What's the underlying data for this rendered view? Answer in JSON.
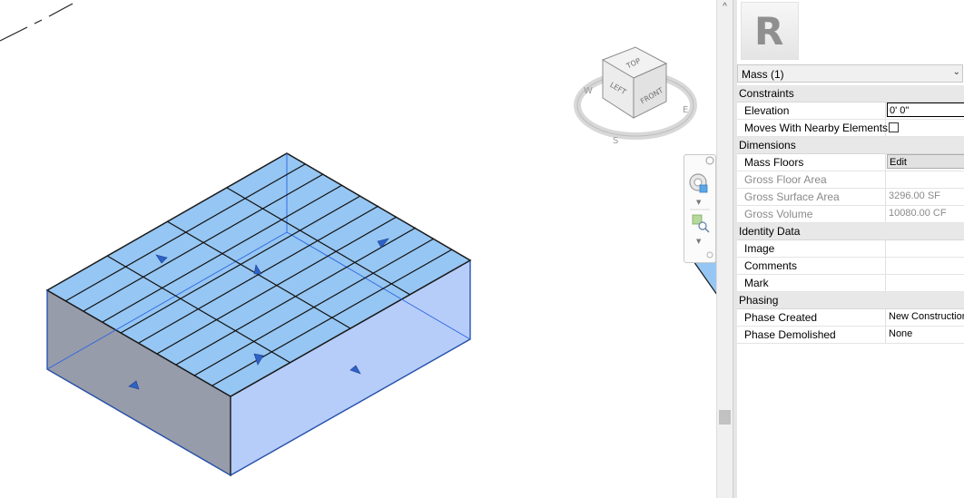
{
  "viewcube": {
    "top": "TOP",
    "left": "LEFT",
    "front": "FRONT"
  },
  "scrollbar": {
    "up_glyph": "^"
  },
  "properties": {
    "type_selector": "Mass (1)",
    "logo_letter": "R",
    "sections": {
      "constraints": {
        "title": "Constraints",
        "elevation_label": "Elevation",
        "elevation_value": "0'  0\"",
        "moves_label": "Moves With Nearby Elements"
      },
      "dimensions": {
        "title": "Dimensions",
        "mass_floors_label": "Mass Floors",
        "mass_floors_button": "Edit",
        "gross_floor_area_label": "Gross Floor Area",
        "gross_floor_area_value": "",
        "gross_surface_area_label": "Gross Surface Area",
        "gross_surface_area_value": "3296.00 SF",
        "gross_volume_label": "Gross Volume",
        "gross_volume_value": "10080.00 CF"
      },
      "identity": {
        "title": "Identity Data",
        "image_label": "Image",
        "comments_label": "Comments",
        "mark_label": "Mark"
      },
      "phasing": {
        "title": "Phasing",
        "created_label": "Phase Created",
        "created_value": "New Construction",
        "demolished_label": "Phase Demolished",
        "demolished_value": "None"
      }
    }
  },
  "colors": {
    "mass_top": "#96c6f3",
    "mass_front": "#b6cdfa",
    "mass_side": "#9197a6",
    "mass_edge": "#1a1a1a",
    "selection_blue": "#1e5bd8"
  }
}
